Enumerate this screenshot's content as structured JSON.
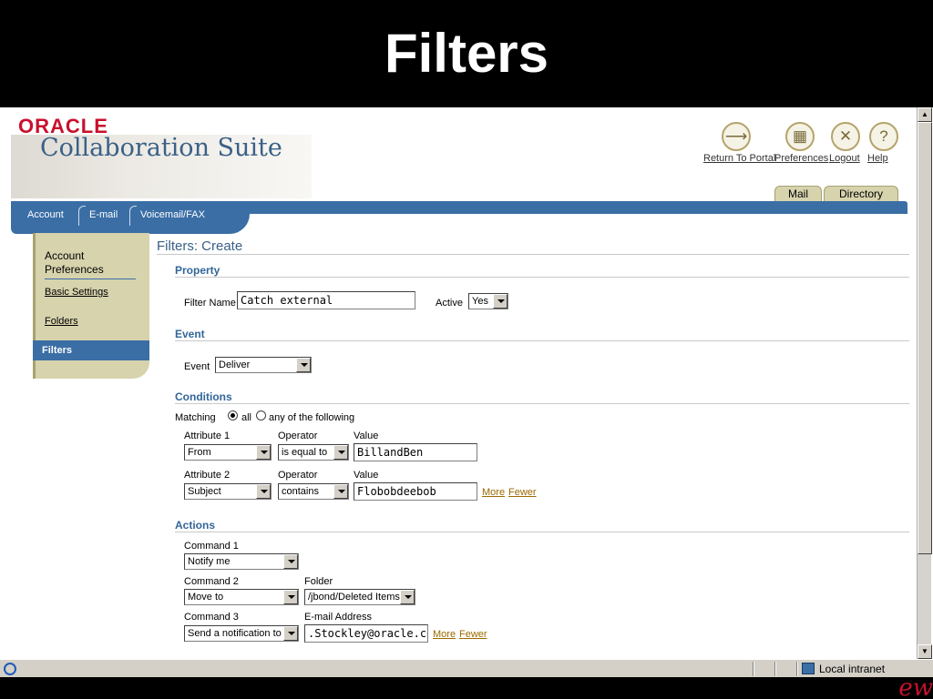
{
  "slide": {
    "title": "Filters"
  },
  "brand": {
    "oracle": "ORACLE",
    "suite": "Collaboration Suite",
    "corner_mark": "ew"
  },
  "global_buttons": [
    {
      "label": "Return To Portal",
      "icon": "return-portal-icon"
    },
    {
      "label": "Preferences",
      "icon": "preferences-icon"
    },
    {
      "label": "Logout",
      "icon": "logout-icon"
    },
    {
      "label": "Help",
      "icon": "help-icon",
      "glyph": "?"
    }
  ],
  "tabs": [
    "Mail",
    "Directory"
  ],
  "subnav": [
    "Account",
    "E-mail",
    "Voicemail/FAX"
  ],
  "side": {
    "heading": "Account Preferences",
    "links": [
      "Basic Settings",
      "Folders"
    ],
    "active": "Filters"
  },
  "page_title": "Filters: Create",
  "property": {
    "heading": "Property",
    "filter_name_label": "Filter Name",
    "filter_name_value": "Catch external",
    "active_label": "Active",
    "active_value": "Yes"
  },
  "event": {
    "heading": "Event",
    "label": "Event",
    "value": "Deliver"
  },
  "conditions": {
    "heading": "Conditions",
    "matching_label": "Matching",
    "option_all": "all",
    "option_any": "any of the following",
    "selected": "all",
    "rows": [
      {
        "attr_label": "Attribute 1",
        "attr_value": "From",
        "op_label": "Operator",
        "op_value": "is equal to",
        "val_label": "Value",
        "value": "BillandBen"
      },
      {
        "attr_label": "Attribute 2",
        "attr_value": "Subject",
        "op_label": "Operator",
        "op_value": "contains",
        "val_label": "Value",
        "value": "Flobobdeebob"
      }
    ],
    "more": "More",
    "fewer": "Fewer"
  },
  "actions": {
    "heading": "Actions",
    "cmd1_label": "Command 1",
    "cmd1_value": "Notify me",
    "cmd2_label": "Command 2",
    "cmd2_value": "Move to",
    "folder_label": "Folder",
    "folder_value": "/jbond/Deleted Items",
    "cmd3_label": "Command 3",
    "cmd3_value": "Send a notification to",
    "email_label": "E-mail Address",
    "email_value": ".Stockley@oracle.com",
    "more": "More",
    "fewer": "Fewer"
  },
  "statusbar": {
    "zone": "Local intranet"
  },
  "colors": {
    "accent_blue": "#3a6ea5",
    "tab_khaki": "#d6d3ad",
    "oracle_red": "#c8102e",
    "section_blue": "#336699"
  }
}
